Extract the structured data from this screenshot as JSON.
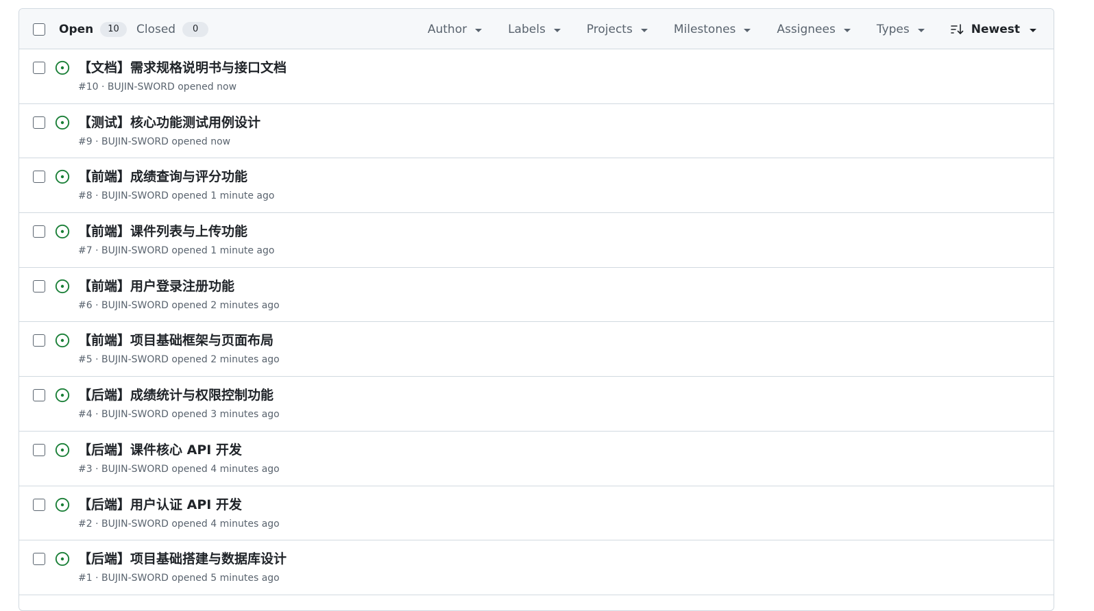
{
  "header": {
    "open_label": "Open",
    "open_count": "10",
    "closed_label": "Closed",
    "closed_count": "0",
    "filters": [
      "Author",
      "Labels",
      "Projects",
      "Milestones",
      "Assignees",
      "Types"
    ],
    "sort_label": "Newest"
  },
  "colors": {
    "open_icon": "#1a7f37",
    "border": "#d1d9e0",
    "header_bg": "#f6f8fa",
    "muted_text": "#59636e"
  },
  "icons": {
    "issue": "issue-opened-icon",
    "sort": "sort-desc-icon",
    "dropdown": "triangle-down-icon"
  },
  "issues": [
    {
      "title": "【文档】需求规格说明书与接口文档",
      "meta": "#10 · BUJIN-SWORD opened now"
    },
    {
      "title": "【测试】核心功能测试用例设计",
      "meta": "#9 · BUJIN-SWORD opened now"
    },
    {
      "title": "【前端】成绩查询与评分功能",
      "meta": "#8 · BUJIN-SWORD opened 1 minute ago"
    },
    {
      "title": "【前端】课件列表与上传功能",
      "meta": "#7 · BUJIN-SWORD opened 1 minute ago"
    },
    {
      "title": "【前端】用户登录注册功能",
      "meta": "#6 · BUJIN-SWORD opened 2 minutes ago"
    },
    {
      "title": "【前端】项目基础框架与页面布局",
      "meta": "#5 · BUJIN-SWORD opened 2 minutes ago"
    },
    {
      "title": "【后端】成绩统计与权限控制功能",
      "meta": "#4 · BUJIN-SWORD opened 3 minutes ago"
    },
    {
      "title": "【后端】课件核心 API 开发",
      "meta": "#3 · BUJIN-SWORD opened 4 minutes ago"
    },
    {
      "title": "【后端】用户认证 API 开发",
      "meta": "#2 · BUJIN-SWORD opened 4 minutes ago"
    },
    {
      "title": "【后端】项目基础搭建与数据库设计",
      "meta": "#1 · BUJIN-SWORD opened 5 minutes ago"
    }
  ]
}
